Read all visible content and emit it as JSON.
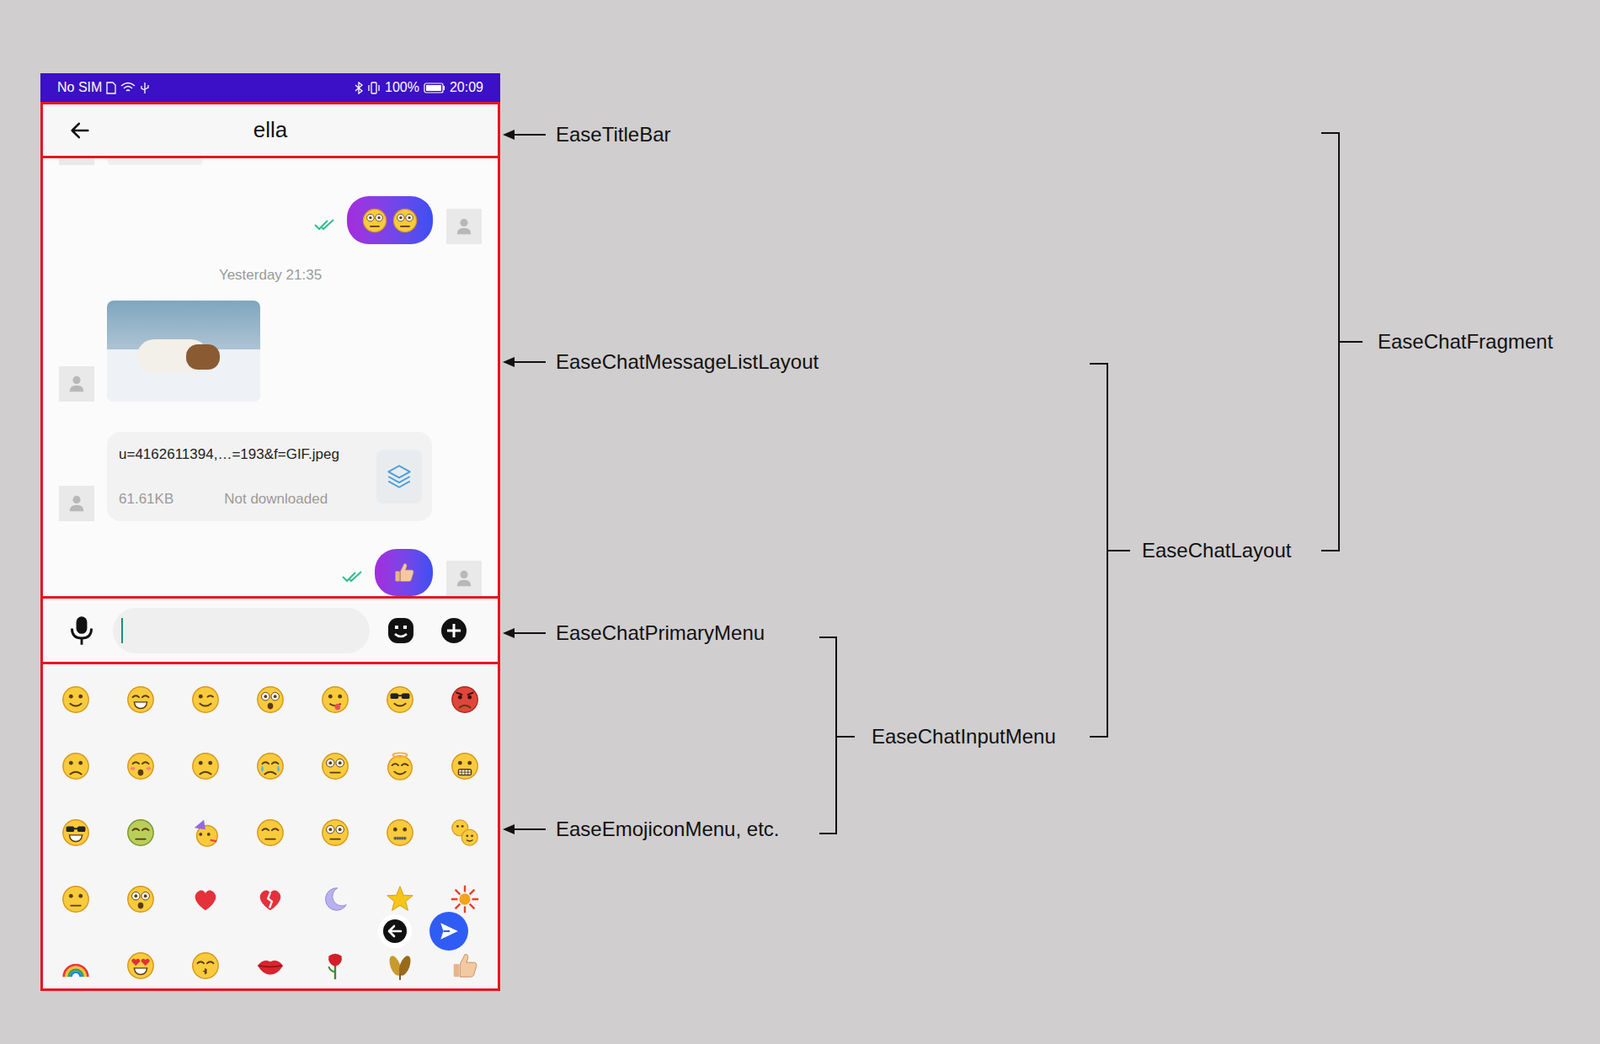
{
  "status_bar": {
    "carrier": "No SIM",
    "battery": "100%",
    "time": "20:09"
  },
  "title_bar": {
    "title": "ella"
  },
  "messages": [
    {
      "kind": "partial",
      "side": "in"
    },
    {
      "kind": "emoji",
      "side": "out",
      "read": true,
      "emojis": [
        "stare",
        "stare"
      ]
    },
    {
      "kind": "time",
      "text": "Yesterday 21:35"
    },
    {
      "kind": "image",
      "side": "in"
    },
    {
      "kind": "file",
      "side": "in",
      "name": "u=4162611394,…=193&f=GIF.jpeg",
      "size": "61.61KB",
      "status": "Not downloaded"
    },
    {
      "kind": "emoji",
      "side": "out",
      "read": true,
      "emojis": [
        "thumb"
      ]
    }
  ],
  "input": {
    "value": "",
    "focused": true
  },
  "emoji_menu": {
    "emojis": [
      {
        "kind": "smile"
      },
      {
        "kind": "grin"
      },
      {
        "kind": "wink"
      },
      {
        "kind": "shock"
      },
      {
        "kind": "tongue"
      },
      {
        "kind": "cool"
      },
      {
        "kind": "angry"
      },
      {
        "kind": "sad"
      },
      {
        "kind": "blush"
      },
      {
        "kind": "frown"
      },
      {
        "kind": "cry"
      },
      {
        "kind": "stare"
      },
      {
        "kind": "angel"
      },
      {
        "kind": "grimace"
      },
      {
        "kind": "nerd"
      },
      {
        "kind": "sick"
      },
      {
        "kind": "party"
      },
      {
        "kind": "meh"
      },
      {
        "kind": "roll"
      },
      {
        "kind": "zip"
      },
      {
        "kind": "pair"
      },
      {
        "kind": "blank"
      },
      {
        "kind": "wow"
      },
      {
        "kind": "heart"
      },
      {
        "kind": "broken-heart"
      },
      {
        "kind": "moon"
      },
      {
        "kind": "star"
      },
      {
        "kind": "sun"
      },
      {
        "kind": "rainbow"
      },
      {
        "kind": "love"
      },
      {
        "kind": "kiss"
      },
      {
        "kind": "lips"
      },
      {
        "kind": "rose"
      },
      {
        "kind": "leaves"
      },
      {
        "kind": "thumb"
      }
    ]
  },
  "annotations": [
    {
      "label": "EaseTitleBar",
      "kind": "arrow"
    },
    {
      "label": "EaseChatMessageListLayout",
      "kind": "arrow"
    },
    {
      "label": "EaseChatPrimaryMenu",
      "kind": "arrow"
    },
    {
      "label": "EaseEmojiconMenu, etc.",
      "kind": "arrow"
    },
    {
      "label": "EaseChatInputMenu",
      "kind": "bracket"
    },
    {
      "label": "EaseChatLayout",
      "kind": "bracket"
    },
    {
      "label": "EaseChatFragment",
      "kind": "bracket"
    }
  ]
}
